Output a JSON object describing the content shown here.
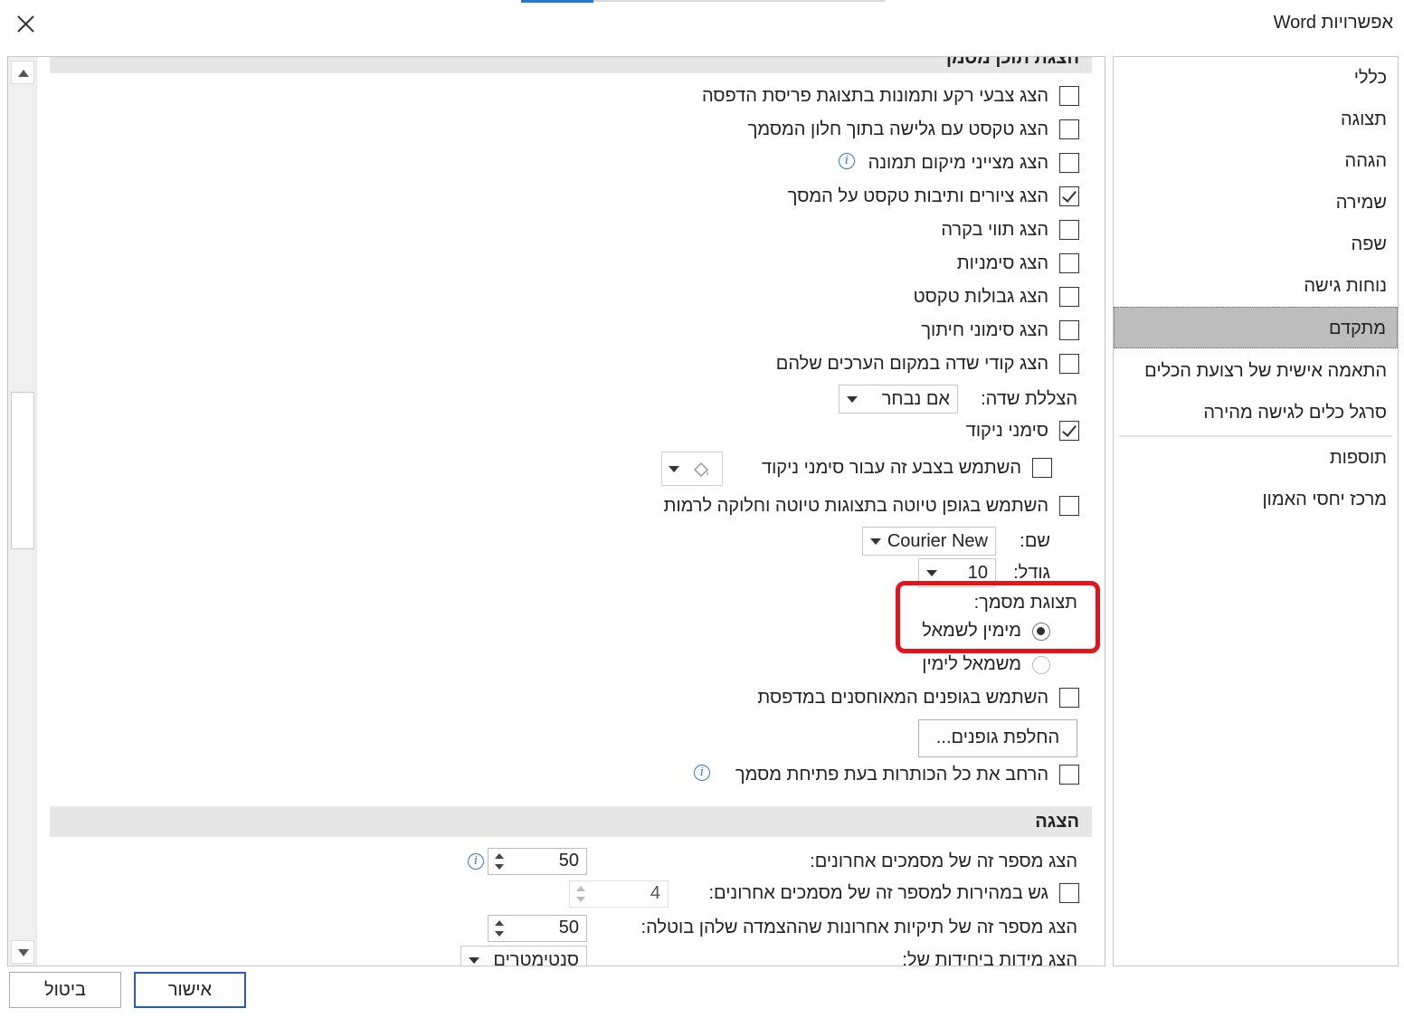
{
  "window": {
    "title": "אפשרויות Word",
    "close_icon": "close-icon"
  },
  "sidebar": {
    "items": [
      {
        "label": "כללי"
      },
      {
        "label": "תצוגה"
      },
      {
        "label": "הגהה"
      },
      {
        "label": "שמירה"
      },
      {
        "label": "שפה"
      },
      {
        "label": "נוחות גישה"
      },
      {
        "label": "מתקדם",
        "selected": true
      },
      {
        "label": "התאמה אישית של רצועת הכלים"
      },
      {
        "label": "סרגל כלים לגישה מהירה"
      },
      {
        "label": "תוספות"
      },
      {
        "label": "מרכז יחסי האמון"
      }
    ]
  },
  "document_content": {
    "section_title": "הצגת תוכן מסמך",
    "options": [
      {
        "label": "הצג צבעי רקע ותמונות בתצוגת פריסת הדפסה",
        "checked": false
      },
      {
        "label": "הצג טקסט עם גלישה בתוך חלון המסמך",
        "checked": false
      },
      {
        "label": "הצג מצייני מיקום תמונה",
        "checked": false
      },
      {
        "label": "הצג ציורים ותיבות טקסט על המסך",
        "checked": true
      },
      {
        "label": "הצג תווי בקרה",
        "checked": false
      },
      {
        "label": "הצג סימניות",
        "checked": false
      },
      {
        "label": "הצג גבולות טקסט",
        "checked": false
      },
      {
        "label": "הצג סימוני חיתוך",
        "checked": false
      },
      {
        "label": "הצג קודי שדה במקום הערכים שלהם",
        "checked": false
      }
    ],
    "field_shading": {
      "label": "הצללת שדה:",
      "value": "אם נבחר"
    },
    "crop_marks": {
      "label": "סימני ניקוד",
      "checked": true
    },
    "use_color_marks": {
      "label": "השתמש בצבע זה עבור סימני ניקוד",
      "checked": false
    },
    "draft_font": {
      "label": "השתמש בגופן טיוטה בתצוגות טיוטה וחלוקה לרמות",
      "checked": false
    },
    "font_name": {
      "label": "שם:",
      "value": "Courier New"
    },
    "font_size": {
      "label": "גודל:",
      "value": "10"
    },
    "doc_view": {
      "label": "תצוגת מסמך:",
      "options": [
        {
          "label": "מימין לשמאל",
          "selected": true
        },
        {
          "label": "משמאל לימין",
          "selected": false
        }
      ]
    },
    "printer_fonts": {
      "label": "השתמש בגופנים המאוחסנים במדפסת",
      "checked": false
    },
    "font_substitution": {
      "label": "החלפת גופנים..."
    },
    "expand_headings": {
      "label": "הרחב את כל הכותרות בעת פתיחת מסמך",
      "checked": false
    }
  },
  "display": {
    "section_title": "הצגה",
    "recent_docs": {
      "label": "הצג מספר זה של מסמכים אחרונים:",
      "value": "50"
    },
    "quick_access": {
      "label": "גש במהירות למספר זה של מסמכים אחרונים:",
      "value": "4",
      "checked": false
    },
    "recent_folders": {
      "label": "הצג מספר זה של תיקיות אחרונות שההצמדה שלהן בוטלה:",
      "value": "50"
    },
    "units": {
      "label": "הצג מידות ביחידות של:",
      "value": "סנטימטרים"
    }
  },
  "footer": {
    "ok": "אישור",
    "cancel": "ביטול"
  },
  "colors": {
    "accent": "#2b78d4",
    "selected_nav": "#bdbdbd",
    "highlight": "#e3141b"
  }
}
